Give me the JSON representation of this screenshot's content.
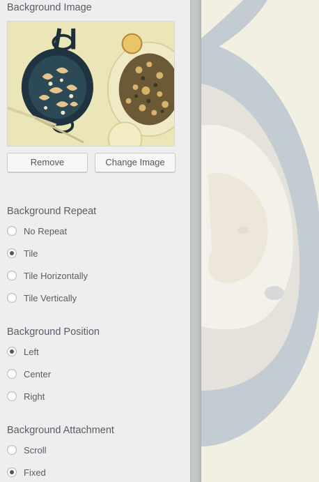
{
  "background_image": {
    "title": "Background Image",
    "thumbnail_alt": "skillet of shrimp pasta and plate of food",
    "remove_label": "Remove",
    "change_label": "Change Image"
  },
  "background_repeat": {
    "title": "Background Repeat",
    "options": [
      {
        "label": "No Repeat",
        "checked": false
      },
      {
        "label": "Tile",
        "checked": true
      },
      {
        "label": "Tile Horizontally",
        "checked": false
      },
      {
        "label": "Tile Vertically",
        "checked": false
      }
    ]
  },
  "background_position": {
    "title": "Background Position",
    "options": [
      {
        "label": "Left",
        "checked": true
      },
      {
        "label": "Center",
        "checked": false
      },
      {
        "label": "Right",
        "checked": false
      }
    ]
  },
  "background_attachment": {
    "title": "Background Attachment",
    "options": [
      {
        "label": "Scroll",
        "checked": false
      },
      {
        "label": "Fixed",
        "checked": true
      }
    ]
  },
  "colors": {
    "panel_bg": "#eeeeee",
    "text": "#555d66",
    "preview_bg": "#f1eee2",
    "skillet": "#c4cdd3"
  }
}
